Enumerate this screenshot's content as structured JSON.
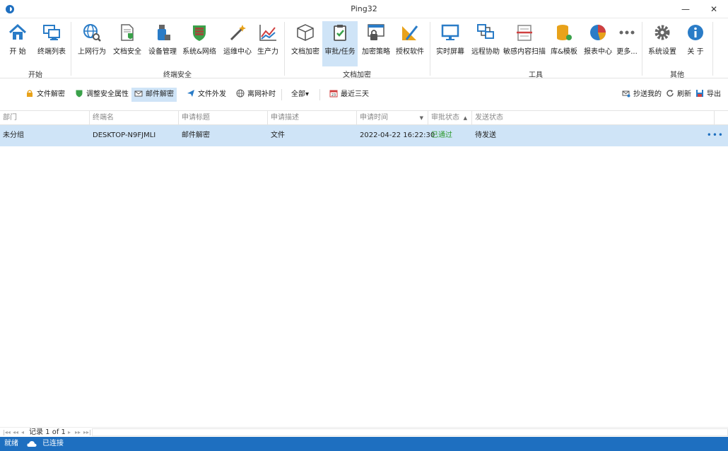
{
  "window": {
    "title": "Ping32",
    "minimize": "—",
    "close": "✕"
  },
  "ribbon": {
    "groups": [
      {
        "label": "开始"
      },
      {
        "label": "终端安全"
      },
      {
        "label": "文档加密"
      },
      {
        "label": "工具"
      },
      {
        "label": "其他"
      }
    ],
    "buttons": [
      {
        "label": "开  始",
        "icon": "home-icon"
      },
      {
        "label": "终端列表",
        "icon": "monitors-icon"
      },
      {
        "label": "上网行为",
        "icon": "globe-search-icon"
      },
      {
        "label": "文档安全",
        "icon": "document-shield-icon"
      },
      {
        "label": "设备管理",
        "icon": "usb-device-icon"
      },
      {
        "label": "系统&网络",
        "icon": "firewall-shield-icon"
      },
      {
        "label": "运维中心",
        "icon": "magic-wand-icon"
      },
      {
        "label": "生产力",
        "icon": "line-chart-icon"
      },
      {
        "label": "文档加密",
        "icon": "cube-icon"
      },
      {
        "label": "审批/任务",
        "icon": "clipboard-check-icon"
      },
      {
        "label": "加密策略",
        "icon": "lock-window-icon"
      },
      {
        "label": "授权软件",
        "icon": "ruler-pencil-icon"
      },
      {
        "label": "实时屏幕",
        "icon": "screen-icon"
      },
      {
        "label": "远程协助",
        "icon": "remote-network-icon"
      },
      {
        "label": "敏感内容扫描",
        "icon": "scan-document-icon"
      },
      {
        "label": "库&模板",
        "icon": "database-icon"
      },
      {
        "label": "报表中心",
        "icon": "pie-chart-icon"
      },
      {
        "label": "更多...",
        "icon": "more-dots-icon"
      },
      {
        "label": "系统设置",
        "icon": "gear-icon"
      },
      {
        "label": "关  于",
        "icon": "info-icon"
      }
    ]
  },
  "toolbar": {
    "items": [
      {
        "label": "文件解密",
        "icon": "lock-icon"
      },
      {
        "label": "调整安全属性",
        "icon": "shield-icon"
      },
      {
        "label": "邮件解密",
        "icon": "mail-icon"
      },
      {
        "label": "文件外发",
        "icon": "send-icon"
      },
      {
        "label": "离网补时",
        "icon": "globe-icon"
      }
    ],
    "filter_all": "全部▾",
    "date_filter": "最近三天",
    "calendar_day": "23",
    "cc_me": "抄送我的",
    "refresh": "刷新",
    "export": "导出"
  },
  "grid": {
    "columns": [
      "部门",
      "终端名",
      "申请标题",
      "申请描述",
      "申请时间",
      "审批状态",
      "发送状态"
    ],
    "rows": [
      [
        "未分组",
        "DESKTOP-N9FJMLI",
        "邮件解密",
        "文件",
        "2022-04-22 16:22:30",
        "已通过",
        "待发送"
      ]
    ],
    "row_more": "•••"
  },
  "pager": {
    "record_text": "记录 1 of 1"
  },
  "status": {
    "ready": "就绪",
    "connection": "已连接"
  },
  "colors": {
    "accent": "#1e6fc0",
    "selection": "#cfe4f7",
    "approved": "#2e9a2e"
  }
}
